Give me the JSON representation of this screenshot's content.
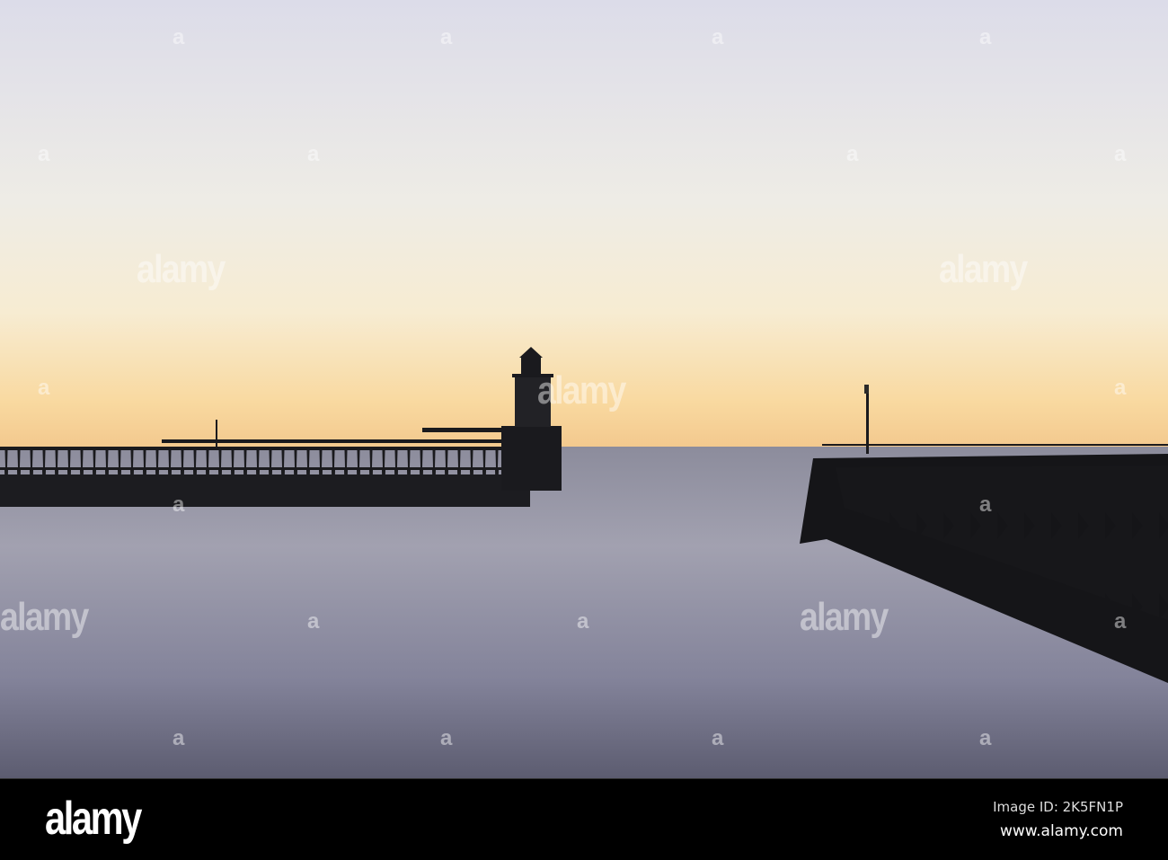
{
  "watermark": {
    "text": "alamy",
    "icon": "a"
  },
  "footer": {
    "logo": "alamy",
    "image_id": "Image ID: 2K5FN1P",
    "url": "www.alamy.com"
  },
  "colors": {
    "sky_top": "#dcdce9",
    "sky_mid": "#f3f0e4",
    "horizon_glow": "#f9d79c",
    "sea": "#9b9bab",
    "silhouette": "#141416"
  }
}
